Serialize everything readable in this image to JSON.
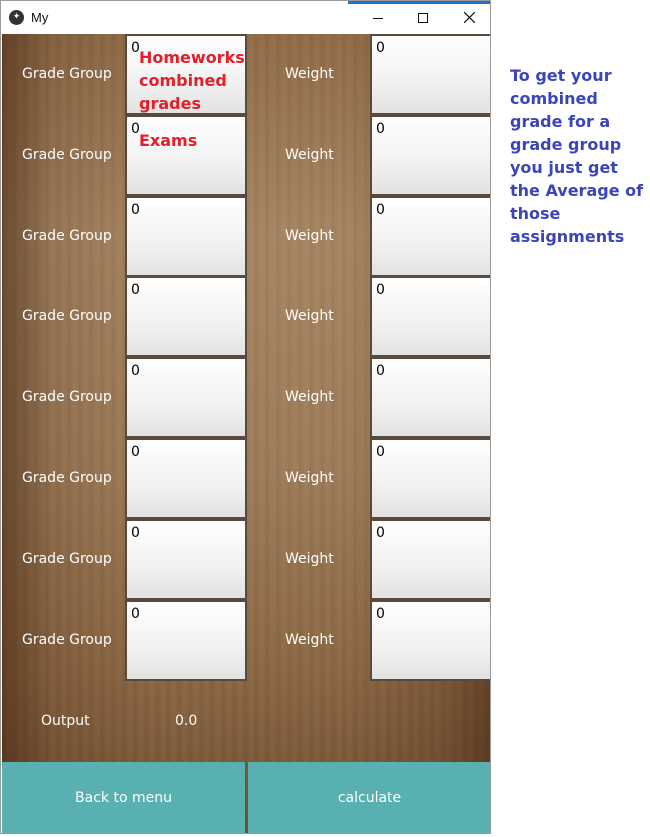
{
  "window": {
    "title": "My",
    "app_icon": "kivy-icon",
    "controls": [
      "minimize-icon",
      "maximize-icon",
      "close-icon"
    ]
  },
  "form": {
    "rows": [
      {
        "group_label": "Grade Group",
        "group_value": "0",
        "group_note": "Homeworks combined grades",
        "weight_label": "Weight",
        "weight_value": "0"
      },
      {
        "group_label": "Grade Group",
        "group_value": "0",
        "group_note": "Exams",
        "weight_label": "Weight",
        "weight_value": "0"
      },
      {
        "group_label": "Grade Group",
        "group_value": "0",
        "group_note": "",
        "weight_label": "Weight",
        "weight_value": "0"
      },
      {
        "group_label": "Grade Group",
        "group_value": "0",
        "group_note": "",
        "weight_label": "Weight",
        "weight_value": "0"
      },
      {
        "group_label": "Grade Group",
        "group_value": "0",
        "group_note": "",
        "weight_label": "Weight",
        "weight_value": "0"
      },
      {
        "group_label": "Grade Group",
        "group_value": "0",
        "group_note": "",
        "weight_label": "Weight",
        "weight_value": "0"
      },
      {
        "group_label": "Grade Group",
        "group_value": "0",
        "group_note": "",
        "weight_label": "Weight",
        "weight_value": "0"
      },
      {
        "group_label": "Grade Group",
        "group_value": "0",
        "group_note": "",
        "weight_label": "Weight",
        "weight_value": "0"
      }
    ],
    "output_label": "Output",
    "output_value": "0.0"
  },
  "buttons": {
    "back": "Back to menu",
    "calculate": "calculate"
  },
  "side_note": "To get your combined grade for a grade group you just get the Average of those assignments",
  "colors": {
    "button_bg": "#58b0b1",
    "annotation_red": "#e0202a",
    "annotation_blue": "#3b45b8"
  }
}
